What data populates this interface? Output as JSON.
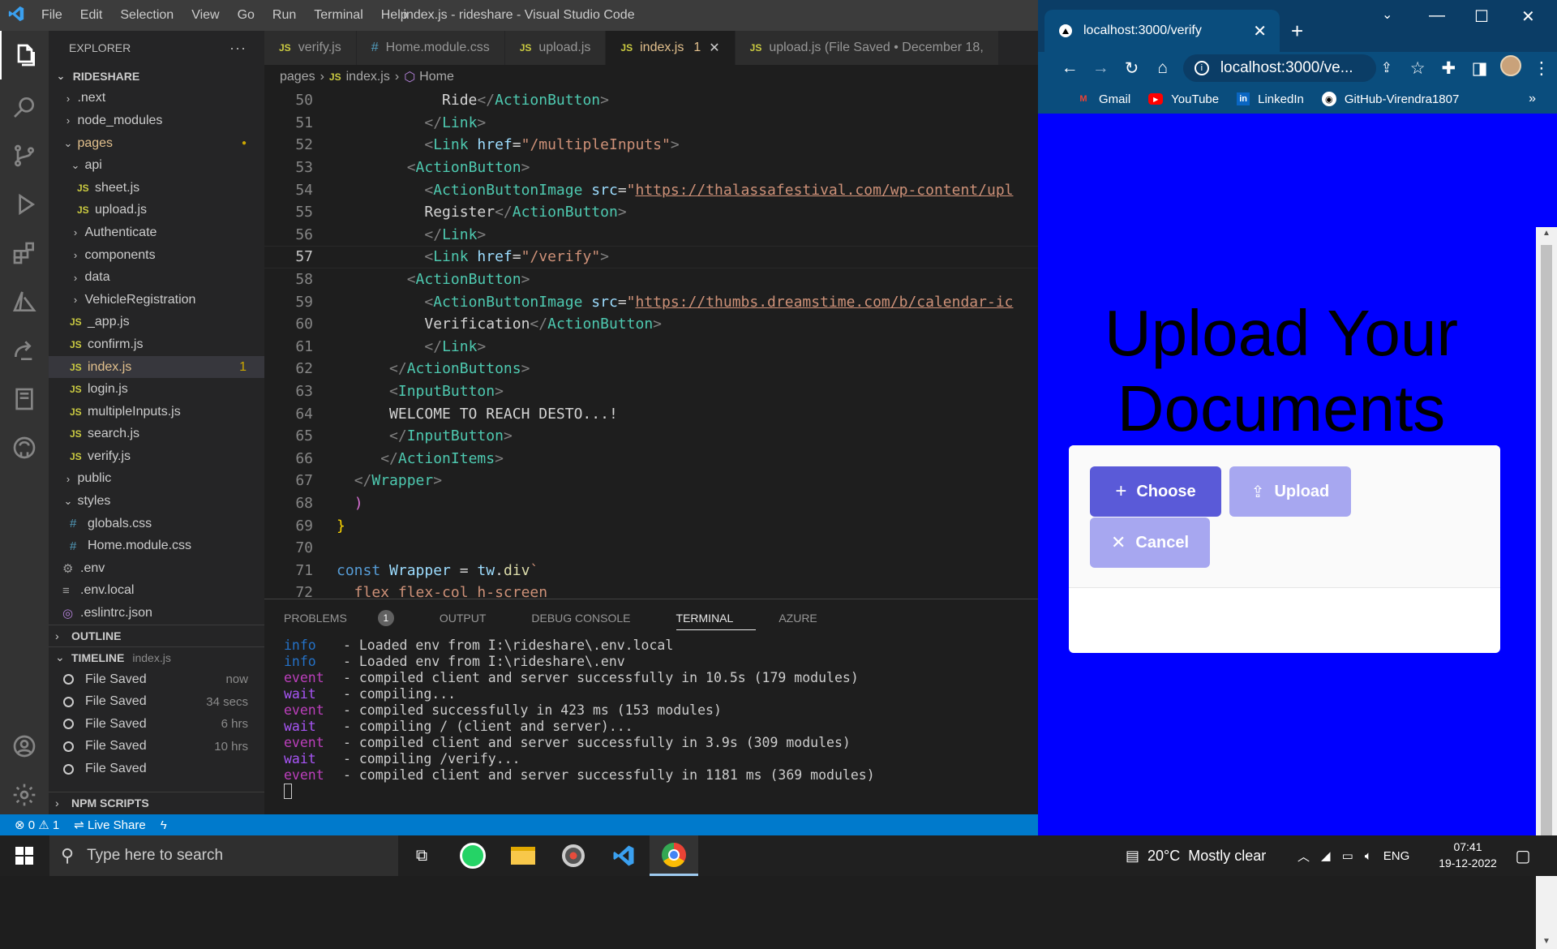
{
  "window": {
    "title": "index.js - rideshare - Visual Studio Code",
    "menu": [
      "File",
      "Edit",
      "Selection",
      "View",
      "Go",
      "Run",
      "Terminal",
      "Help"
    ]
  },
  "explorer": {
    "header": "EXPLORER",
    "root": "RIDESHARE",
    "items": [
      {
        "label": ".next",
        "type": "folder-closed",
        "indent": 1
      },
      {
        "label": "node_modules",
        "type": "folder-closed",
        "indent": 1
      },
      {
        "label": "pages",
        "type": "folder-open",
        "indent": 1
      },
      {
        "label": "api",
        "type": "folder-open",
        "indent": 2
      },
      {
        "label": "sheet.js",
        "type": "js",
        "indent": 3
      },
      {
        "label": "upload.js",
        "type": "js",
        "indent": 3
      },
      {
        "label": "Authenticate",
        "type": "folder-closed",
        "indent": 2
      },
      {
        "label": "components",
        "type": "folder-closed",
        "indent": 2
      },
      {
        "label": "data",
        "type": "folder-closed",
        "indent": 2
      },
      {
        "label": "VehicleRegistration",
        "type": "folder-closed",
        "indent": 2
      },
      {
        "label": "_app.js",
        "type": "js",
        "indent": 2
      },
      {
        "label": "confirm.js",
        "type": "js",
        "indent": 2
      },
      {
        "label": "index.js",
        "type": "js",
        "indent": 2,
        "selected": true,
        "badge": "1"
      },
      {
        "label": "login.js",
        "type": "js",
        "indent": 2
      },
      {
        "label": "multipleInputs.js",
        "type": "js",
        "indent": 2
      },
      {
        "label": "search.js",
        "type": "js",
        "indent": 2
      },
      {
        "label": "verify.js",
        "type": "js",
        "indent": 2
      },
      {
        "label": "public",
        "type": "folder-closed",
        "indent": 1
      },
      {
        "label": "styles",
        "type": "folder-open",
        "indent": 1
      },
      {
        "label": "globals.css",
        "type": "css",
        "indent": 2
      },
      {
        "label": "Home.module.css",
        "type": "css",
        "indent": 2
      },
      {
        "label": ".env",
        "type": "gear",
        "indent": 1
      },
      {
        "label": ".env.local",
        "type": "lines",
        "indent": 1
      },
      {
        "label": ".eslintrc.json",
        "type": "eslint",
        "indent": 1
      }
    ],
    "outline": "OUTLINE",
    "timeline": {
      "label": "TIMELINE",
      "file": "index.js",
      "entries": [
        {
          "label": "File Saved",
          "time": "now"
        },
        {
          "label": "File Saved",
          "time": "34 secs"
        },
        {
          "label": "File Saved",
          "time": "6 hrs"
        },
        {
          "label": "File Saved",
          "time": "10 hrs"
        },
        {
          "label": "File Saved",
          "time": ""
        }
      ]
    },
    "npm": "NPM SCRIPTS"
  },
  "tabs": [
    {
      "label": "verify.js",
      "type": "js"
    },
    {
      "label": "Home.module.css",
      "type": "css"
    },
    {
      "label": "upload.js",
      "type": "js"
    },
    {
      "label": "index.js",
      "type": "js",
      "active": true,
      "badge": "1"
    },
    {
      "label": "upload.js (File Saved • December 18,",
      "type": "js"
    }
  ],
  "breadcrumb": {
    "a": "pages",
    "b": "index.js",
    "c": "Home"
  },
  "code": [
    {
      "n": "50",
      "t": [
        [
          "pl",
          "            Ride"
        ],
        [
          "tg",
          "</"
        ],
        [
          "tn",
          "ActionButton"
        ],
        [
          "tg",
          ">"
        ]
      ]
    },
    {
      "n": "51",
      "t": [
        [
          "pl",
          "          "
        ],
        [
          "tg",
          "</"
        ],
        [
          "tn",
          "Link"
        ],
        [
          "tg",
          ">"
        ]
      ]
    },
    {
      "n": "52",
      "t": [
        [
          "pl",
          "          "
        ],
        [
          "tg",
          "<"
        ],
        [
          "tn",
          "Link"
        ],
        [
          "pl",
          " "
        ],
        [
          "at",
          "href"
        ],
        [
          "pl",
          "="
        ],
        [
          "st",
          "\"/multipleInputs\""
        ],
        [
          "tg",
          ">"
        ]
      ]
    },
    {
      "n": "53",
      "t": [
        [
          "pl",
          "        "
        ],
        [
          "tg",
          "<"
        ],
        [
          "tn",
          "ActionButton"
        ],
        [
          "tg",
          ">"
        ]
      ]
    },
    {
      "n": "54",
      "t": [
        [
          "pl",
          "          "
        ],
        [
          "tg",
          "<"
        ],
        [
          "tn",
          "ActionButtonImage"
        ],
        [
          "pl",
          " "
        ],
        [
          "at",
          "src"
        ],
        [
          "pl",
          "="
        ],
        [
          "st",
          "\""
        ],
        [
          "url",
          "https://thalassafestival.com/wp-content/upl"
        ]
      ]
    },
    {
      "n": "55",
      "t": [
        [
          "pl",
          "          Register"
        ],
        [
          "tg",
          "</"
        ],
        [
          "tn",
          "ActionButton"
        ],
        [
          "tg",
          ">"
        ]
      ]
    },
    {
      "n": "56",
      "t": [
        [
          "pl",
          "          "
        ],
        [
          "tg",
          "</"
        ],
        [
          "tn",
          "Link"
        ],
        [
          "tg",
          ">"
        ]
      ]
    },
    {
      "n": "57",
      "t": [
        [
          "pl",
          "          "
        ],
        [
          "tg",
          "<"
        ],
        [
          "tn",
          "Link"
        ],
        [
          "pl",
          " "
        ],
        [
          "at",
          "href"
        ],
        [
          "pl",
          "="
        ],
        [
          "st",
          "\"/verify\""
        ],
        [
          "tg",
          ">"
        ]
      ],
      "current": true
    },
    {
      "n": "58",
      "t": [
        [
          "pl",
          "        "
        ],
        [
          "tg",
          "<"
        ],
        [
          "tn",
          "ActionButton"
        ],
        [
          "tg",
          ">"
        ]
      ]
    },
    {
      "n": "59",
      "t": [
        [
          "pl",
          "          "
        ],
        [
          "tg",
          "<"
        ],
        [
          "tn",
          "ActionButtonImage"
        ],
        [
          "pl",
          " "
        ],
        [
          "at",
          "src"
        ],
        [
          "pl",
          "="
        ],
        [
          "st",
          "\""
        ],
        [
          "url",
          "https://thumbs.dreamstime.com/b/calendar-ic"
        ]
      ]
    },
    {
      "n": "60",
      "t": [
        [
          "pl",
          "          Verification"
        ],
        [
          "tg",
          "</"
        ],
        [
          "tn",
          "ActionButton"
        ],
        [
          "tg",
          ">"
        ]
      ]
    },
    {
      "n": "61",
      "t": [
        [
          "pl",
          "          "
        ],
        [
          "tg",
          "</"
        ],
        [
          "tn",
          "Link"
        ],
        [
          "tg",
          ">"
        ]
      ]
    },
    {
      "n": "62",
      "t": [
        [
          "pl",
          "      "
        ],
        [
          "tg",
          "</"
        ],
        [
          "tn",
          "ActionButtons"
        ],
        [
          "tg",
          ">"
        ]
      ]
    },
    {
      "n": "63",
      "t": [
        [
          "pl",
          "      "
        ],
        [
          "tg",
          "<"
        ],
        [
          "tn",
          "InputButton"
        ],
        [
          "tg",
          ">"
        ]
      ]
    },
    {
      "n": "64",
      "t": [
        [
          "pl",
          "      WELCOME TO REACH DESTO...!"
        ]
      ]
    },
    {
      "n": "65",
      "t": [
        [
          "pl",
          "      "
        ],
        [
          "tg",
          "</"
        ],
        [
          "tn",
          "InputButton"
        ],
        [
          "tg",
          ">"
        ]
      ]
    },
    {
      "n": "66",
      "t": [
        [
          "pl",
          "     "
        ],
        [
          "tg",
          "</"
        ],
        [
          "tn",
          "ActionItems"
        ],
        [
          "tg",
          ">"
        ]
      ]
    },
    {
      "n": "67",
      "t": [
        [
          "pl",
          "  "
        ],
        [
          "tg",
          "</"
        ],
        [
          "tn",
          "Wrapper"
        ],
        [
          "tg",
          ">"
        ]
      ]
    },
    {
      "n": "68",
      "t": [
        [
          "pl",
          "  "
        ],
        [
          "br",
          ")"
        ]
      ]
    },
    {
      "n": "69",
      "t": [
        [
          "by",
          "}"
        ]
      ]
    },
    {
      "n": "70",
      "t": [
        [
          "pl",
          ""
        ]
      ]
    },
    {
      "n": "71",
      "t": [
        [
          "kw",
          "const"
        ],
        [
          "pl",
          " "
        ],
        [
          "at",
          "Wrapper"
        ],
        [
          "pl",
          " = "
        ],
        [
          "at",
          "tw"
        ],
        [
          "pl",
          "."
        ],
        [
          "fn",
          "div"
        ],
        [
          "st",
          "`"
        ]
      ]
    },
    {
      "n": "72",
      "t": [
        [
          "st",
          "  flex flex-col h-screen"
        ]
      ]
    }
  ],
  "panel": {
    "tabs": [
      "PROBLEMS",
      "OUTPUT",
      "DEBUG CONSOLE",
      "TERMINAL",
      "AZURE"
    ],
    "problems_count": "1",
    "active": "TERMINAL",
    "terminal": [
      {
        "k": "info",
        "m": "- Loaded env from I:\\rideshare\\.env.local"
      },
      {
        "k": "info",
        "m": "- Loaded env from I:\\rideshare\\.env"
      },
      {
        "k": "event",
        "m": "- compiled client and server successfully in 10.5s (179 modules)"
      },
      {
        "k": "wait",
        "m": "- compiling..."
      },
      {
        "k": "event",
        "m": "- compiled successfully in 423 ms (153 modules)"
      },
      {
        "k": "wait",
        "m": "- compiling / (client and server)..."
      },
      {
        "k": "event",
        "m": "- compiled client and server successfully in 3.9s (309 modules)"
      },
      {
        "k": "wait",
        "m": "- compiling /verify..."
      },
      {
        "k": "event",
        "m": "- compiled client and server successfully in 1181 ms (369 modules)"
      }
    ]
  },
  "status": {
    "errors": "0",
    "warnings": "1",
    "liveshare": "Live Share"
  },
  "browser": {
    "tab_title": "localhost:3000/verify",
    "url": "localhost:3000/ve...",
    "bookmarks": [
      "Gmail",
      "YouTube",
      "LinkedIn",
      "GitHub-Virendra1807"
    ],
    "heading": "Upload Your Documents",
    "buttons": {
      "choose": "Choose",
      "upload": "Upload",
      "cancel": "Cancel"
    },
    "colors": {
      "page_bg": "#0000ff",
      "choose": "#5a5ad8",
      "upload_disabled": "#a7a7f0"
    }
  },
  "taskbar": {
    "search_placeholder": "Type here to search",
    "weather": "20°C  Mostly clear",
    "lang": "ENG",
    "time": "07:41",
    "date": "19-12-2022"
  }
}
